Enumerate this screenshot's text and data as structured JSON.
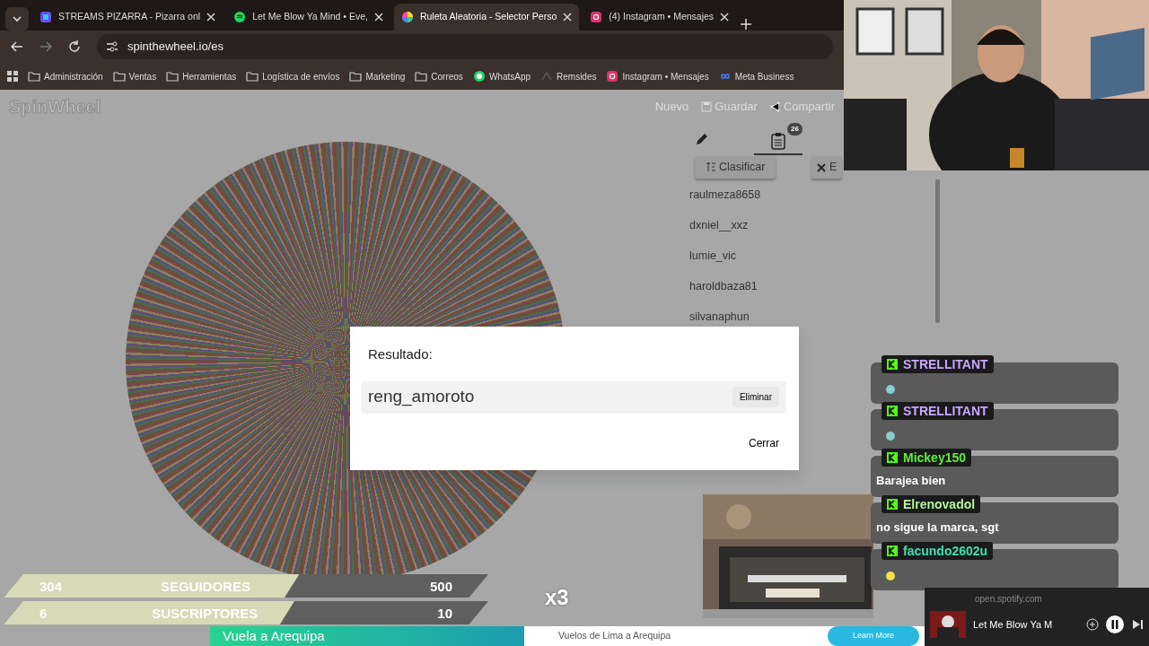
{
  "tabs": [
    {
      "title": "STREAMS PIZARRA - Pizarra onl",
      "selected": false,
      "kind": "board"
    },
    {
      "title": "Let Me Blow Ya Mind • Eve,",
      "selected": false,
      "kind": "spotify"
    },
    {
      "title": "Ruleta Aleatoria - Selector Perso",
      "selected": true,
      "kind": "wheel"
    },
    {
      "title": "(4) Instagram • Mensajes",
      "selected": false,
      "kind": "instagram"
    }
  ],
  "address": "spinthewheel.io/es",
  "bookmarks": [
    {
      "label": "Administración",
      "kind": "folder"
    },
    {
      "label": "Ventas",
      "kind": "folder"
    },
    {
      "label": "Herramientas",
      "kind": "folder"
    },
    {
      "label": "Logística de envíos",
      "kind": "folder"
    },
    {
      "label": "Marketing",
      "kind": "folder"
    },
    {
      "label": "Correos",
      "kind": "folder"
    },
    {
      "label": "WhatsApp",
      "kind": "whatsapp"
    },
    {
      "label": "Remsides",
      "kind": "site"
    },
    {
      "label": "Instagram • Mensajes",
      "kind": "instagram"
    },
    {
      "label": "Meta Business",
      "kind": "meta"
    }
  ],
  "app": {
    "logo": "SpinWheel",
    "actions": [
      "Nuevo",
      "Guardar",
      "Compartir"
    ],
    "entries_badge": "26",
    "sort_button": "Clasificar",
    "clear_button": "E",
    "entries": [
      "raulmeza8658",
      "dxniel__xxz",
      "lumie_vic",
      "haroldbaza81",
      "silvanaphun"
    ]
  },
  "dialog": {
    "title": "Resultado:",
    "result": "reng_amoroto",
    "remove_button": "Eliminar",
    "close_button": "Cerrar"
  },
  "counters": [
    {
      "value": "304",
      "label": "SEGUIDORES",
      "goal": "500",
      "level": 0.61
    },
    {
      "value": "6",
      "label": "SUSCRIPTORES",
      "goal": "10",
      "level": 0.6
    }
  ],
  "multiplier": "x3",
  "chat": [
    {
      "user": "STRELLITANT",
      "color": "#c9a6ff"
    },
    {
      "user": "STRELLITANT",
      "color": "#c9a6ff"
    },
    {
      "user": "Mickey150",
      "color": "#5cef3a",
      "message": "Barajea bien"
    },
    {
      "user": "Elrenovadol",
      "color": "#b4f59a",
      "message": "no sigue la marca, sgt"
    },
    {
      "user": "facundo2602u",
      "color": "#3fe0b0"
    }
  ],
  "ad": {
    "headline": "Vuela a Arequipa",
    "text": "Vuelos de Lima a Arequipa",
    "button": "Learn More"
  },
  "player": {
    "site": "open.spotify.com",
    "track": "Let Me Blow Ya M"
  }
}
